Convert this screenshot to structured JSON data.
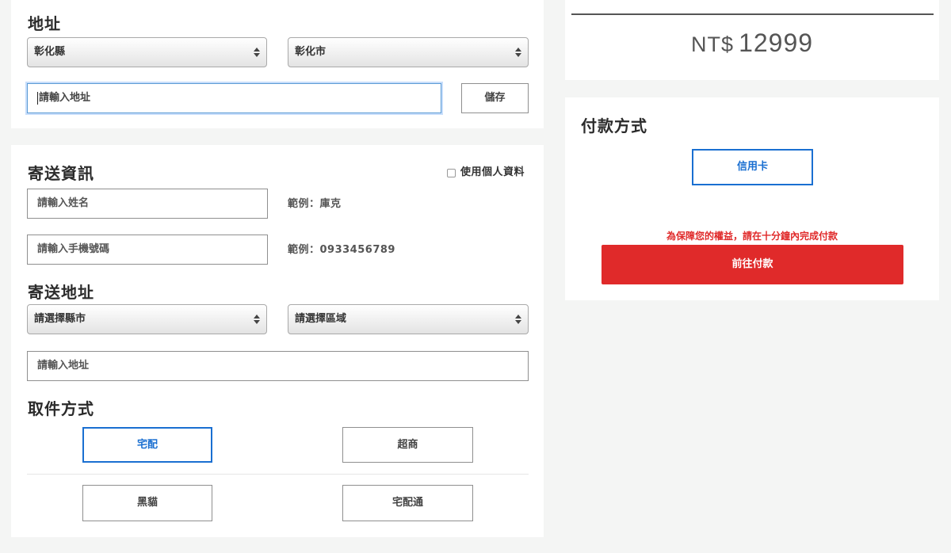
{
  "address": {
    "title": "地址",
    "county_value": "彰化縣",
    "city_value": "彰化市",
    "input_placeholder": "請輸入地址",
    "save_label": "儲存"
  },
  "shipping_info": {
    "title": "寄送資訊",
    "use_profile_label": "使用個人資料",
    "name_placeholder": "請輸入姓名",
    "name_hint": "範例：庫克",
    "phone_placeholder": "請輸入手機號碼",
    "phone_hint": "範例：0933456789"
  },
  "shipping_address": {
    "title": "寄送地址",
    "county_value": "請選擇縣市",
    "district_value": "請選擇區域",
    "input_placeholder": "請輸入地址"
  },
  "pickup": {
    "title": "取件方式",
    "options": [
      "宅配",
      "超商",
      "黑貓",
      "宅配通"
    ],
    "selected": "宅配"
  },
  "summary": {
    "currency": "NT$",
    "total": "12999"
  },
  "payment": {
    "title": "付款方式",
    "method_label": "信用卡",
    "warning": "為保障您的權益，請在十分鐘內完成付款",
    "pay_label": "前往付款"
  },
  "colors": {
    "accent_blue": "#1a6fd1",
    "pay_red": "#e02a2a",
    "warning_red": "#e02a2a"
  }
}
